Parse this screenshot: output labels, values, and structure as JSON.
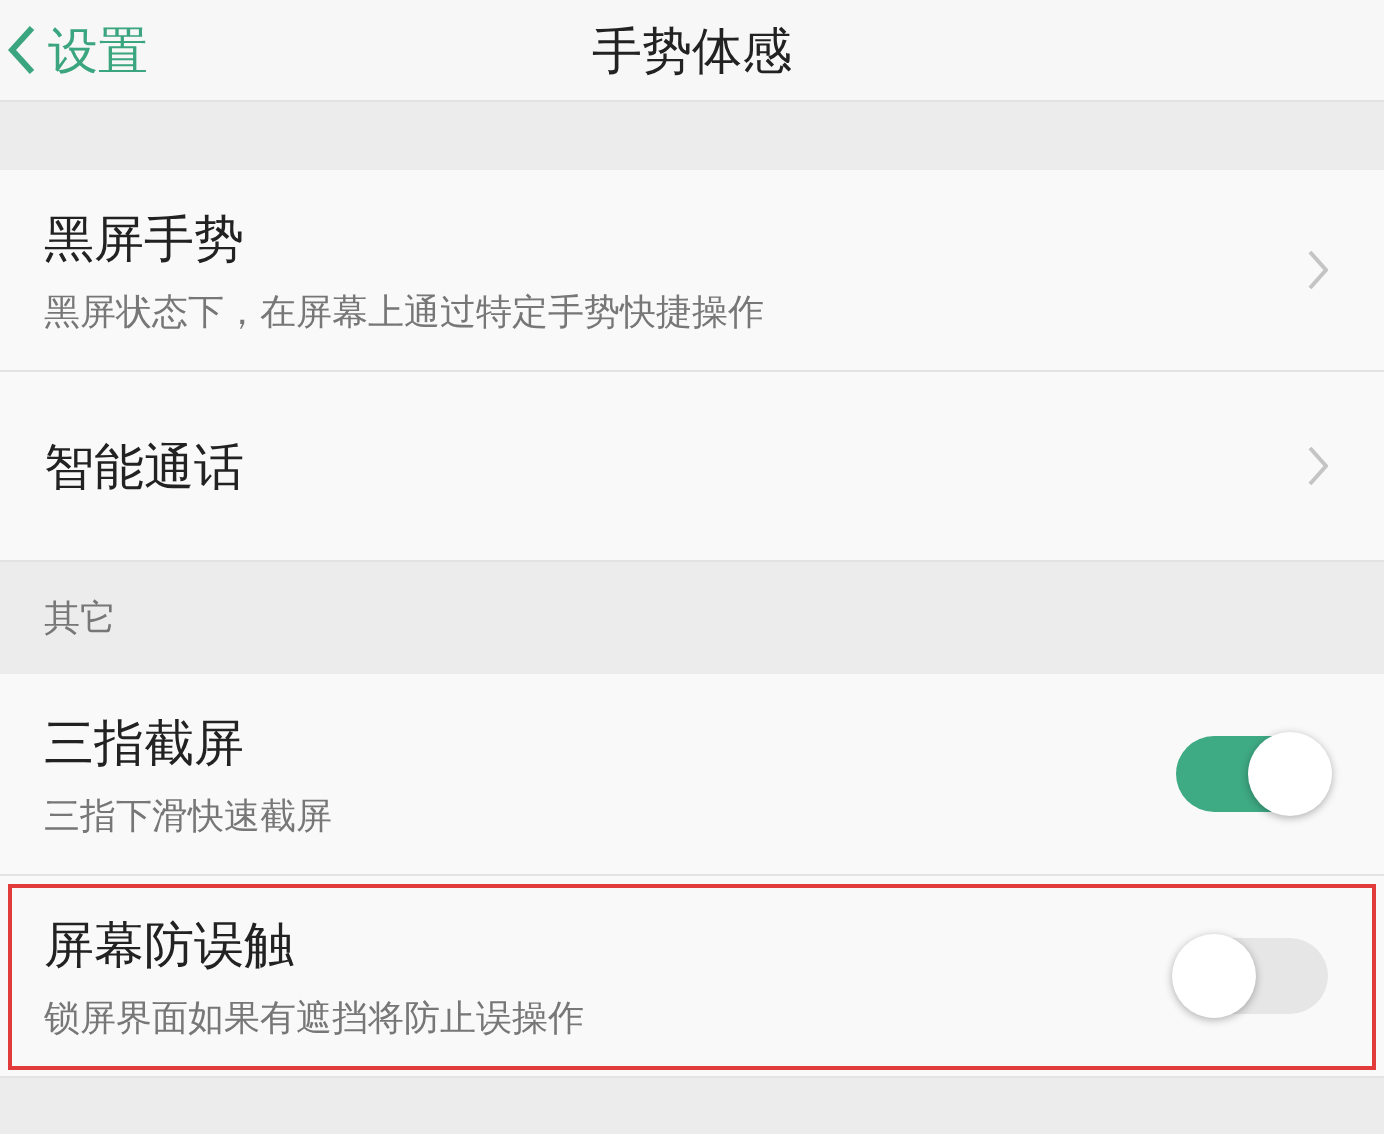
{
  "nav": {
    "back_label": "设置",
    "title": "手势体感"
  },
  "sections": [
    {
      "items": [
        {
          "kind": "link",
          "title": "黑屏手势",
          "subtitle": "黑屏状态下，在屏幕上通过特定手势快捷操作",
          "highlighted": false
        },
        {
          "kind": "link",
          "title": "智能通话",
          "highlighted": false
        }
      ]
    },
    {
      "header": "其它",
      "items": [
        {
          "kind": "toggle",
          "title": "三指截屏",
          "subtitle": "三指下滑快速截屏",
          "on": true,
          "highlighted": false
        },
        {
          "kind": "toggle",
          "title": "屏幕防误触",
          "subtitle": "锁屏界面如果有遮挡将防止误操作",
          "on": false,
          "highlighted": true
        }
      ]
    }
  ]
}
